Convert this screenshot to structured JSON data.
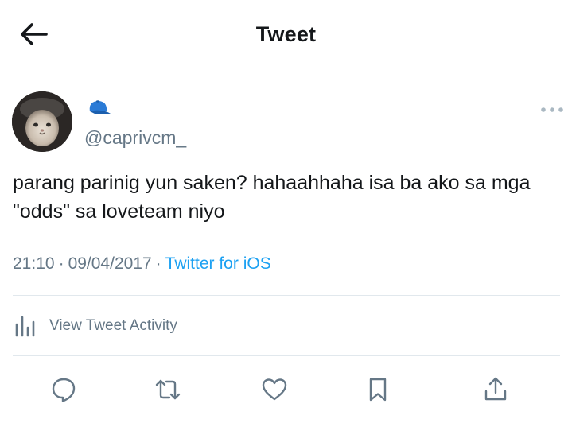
{
  "header": {
    "title": "Tweet"
  },
  "tweet": {
    "handle": "@caprivcm_",
    "text": "parang parinig yun saken? hahaahhaha isa ba ako sa mga \"odds\" sa loveteam niyo",
    "time": "21:10",
    "date": "09/04/2017",
    "separator": "·",
    "source": "Twitter for iOS"
  },
  "activity": {
    "label": "View Tweet Activity"
  },
  "icons": {
    "back": "arrow-left-icon",
    "name_emoji": "blue-cap-icon",
    "more": "more-horizontal-icon",
    "activity": "bar-chart-icon",
    "reply": "reply-icon",
    "retweet": "retweet-icon",
    "like": "heart-icon",
    "bookmark": "bookmark-icon",
    "share": "share-icon"
  },
  "colors": {
    "text": "#14171a",
    "secondary": "#657786",
    "link": "#1da1f2",
    "divider": "#e1e8ed",
    "icon": "#657786"
  }
}
